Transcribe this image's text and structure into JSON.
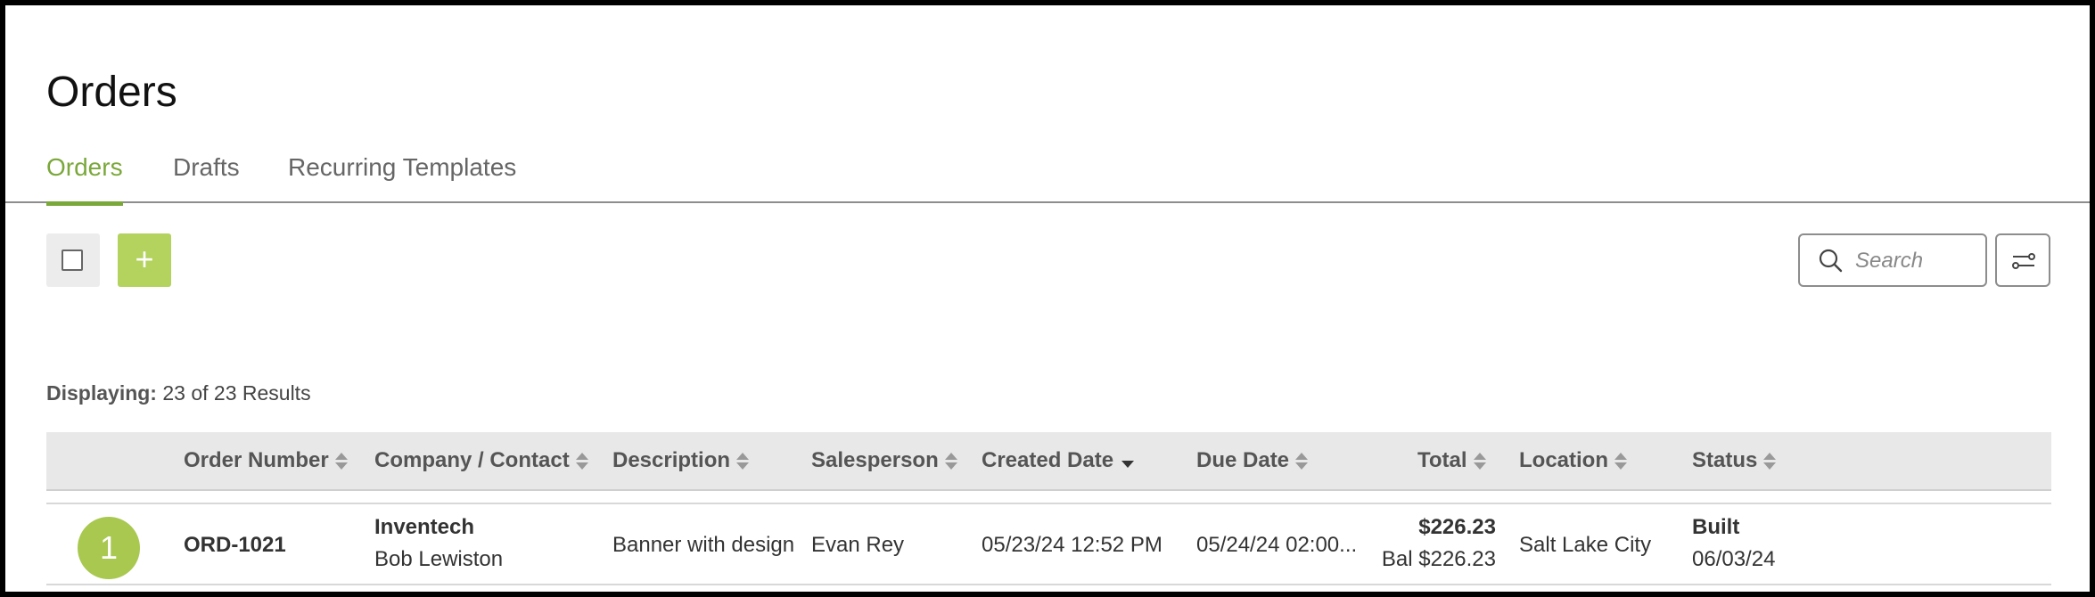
{
  "page": {
    "title": "Orders"
  },
  "tabs": [
    {
      "label": "Orders",
      "active": true
    },
    {
      "label": "Drafts",
      "active": false
    },
    {
      "label": "Recurring Templates",
      "active": false
    }
  ],
  "toolbar": {
    "add_label": "+",
    "search_placeholder": "Search"
  },
  "results": {
    "label": "Displaying:",
    "text": "23 of 23 Results"
  },
  "table": {
    "columns": [
      "Order Number",
      "Company / Contact",
      "Description",
      "Salesperson",
      "Created Date",
      "Due Date",
      "Total",
      "Location",
      "Status"
    ],
    "sorted_column": "Created Date",
    "rows": [
      {
        "index": "1",
        "order_number": "ORD-1021",
        "company": "Inventech",
        "contact": "Bob Lewiston",
        "description": "Banner with design",
        "salesperson": "Evan Rey",
        "created_date": "05/23/24 12:52 PM",
        "due_date": "05/24/24 02:00...",
        "total": "$226.23",
        "balance": "Bal $226.23",
        "location": "Salt Lake City",
        "status": "Built",
        "status_date": "06/03/24"
      }
    ]
  },
  "colors": {
    "accent": "#7aa83a",
    "add_button": "#b3d35e",
    "badge": "#a8c850",
    "header_bg": "#e8e8e8"
  }
}
